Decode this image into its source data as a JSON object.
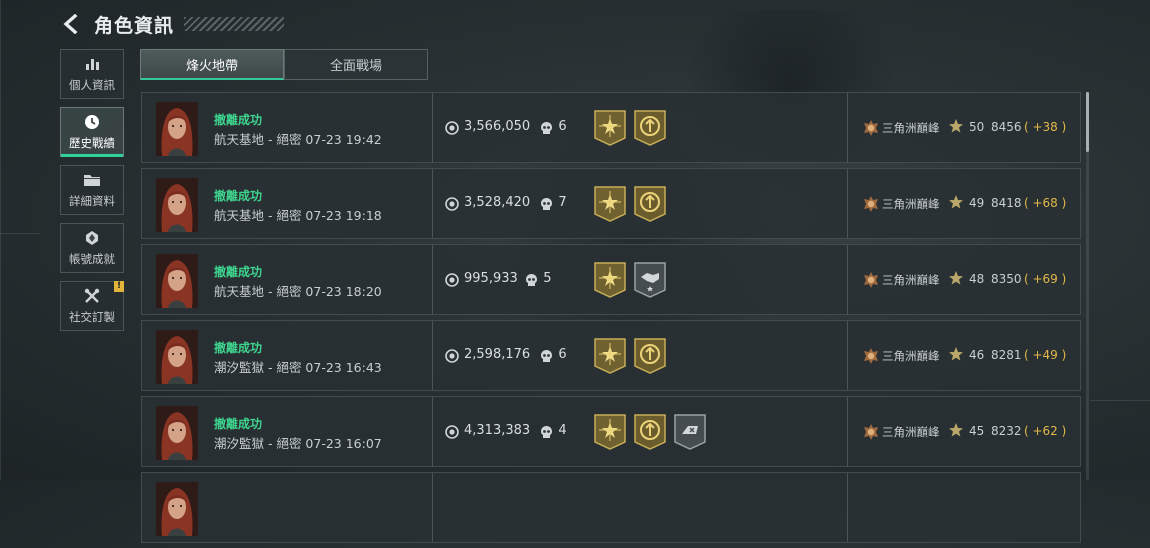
{
  "header": {
    "title": "角色資訊",
    "back_icon": "chevron-left-icon"
  },
  "nav": [
    {
      "label": "個人資訊",
      "icon": "bar-chart-icon",
      "active": false
    },
    {
      "label": "歷史戰績",
      "icon": "clock-icon",
      "active": true
    },
    {
      "label": "詳細資料",
      "icon": "folder-icon",
      "active": false
    },
    {
      "label": "帳號成就",
      "icon": "achievement-icon",
      "active": false
    },
    {
      "label": "社交訂製",
      "icon": "tools-icon",
      "active": false,
      "badge": "!"
    }
  ],
  "tabs": [
    {
      "label": "烽火地帶",
      "active": true
    },
    {
      "label": "全面戰場",
      "active": false
    }
  ],
  "records": [
    {
      "status": "撤離成功",
      "map": "航天基地 - 絕密 07-23 19:42",
      "value": "3,566,050",
      "kills": "6",
      "badges": [
        "gold-star-badge",
        "gold-shield-badge"
      ],
      "rank": "三角洲巔峰",
      "level": "50",
      "score": "8456",
      "delta": "( +38 )"
    },
    {
      "status": "撤離成功",
      "map": "航天基地 - 絕密 07-23 19:18",
      "value": "3,528,420",
      "kills": "7",
      "badges": [
        "gold-star-badge",
        "gold-shield-badge"
      ],
      "rank": "三角洲巔峰",
      "level": "49",
      "score": "8418",
      "delta": "( +68 )"
    },
    {
      "status": "撤離成功",
      "map": "航天基地 - 絕密 07-23 18:20",
      "value": "995,933",
      "kills": "5",
      "badges": [
        "gold-star-badge",
        "grey-handshake-badge"
      ],
      "rank": "三角洲巔峰",
      "level": "48",
      "score": "8350",
      "delta": "( +69 )"
    },
    {
      "status": "撤離成功",
      "map": "潮汐監獄 - 絕密 07-23 16:43",
      "value": "2,598,176",
      "kills": "6",
      "badges": [
        "gold-star-badge",
        "gold-shield-badge"
      ],
      "rank": "三角洲巔峰",
      "level": "46",
      "score": "8281",
      "delta": "( +49 )"
    },
    {
      "status": "撤離成功",
      "map": "潮汐監獄 - 絕密 07-23 16:07",
      "value": "4,313,383",
      "kills": "4",
      "badges": [
        "gold-star-badge",
        "gold-shield-badge",
        "grey-item-badge"
      ],
      "rank": "三角洲巔峰",
      "level": "45",
      "score": "8232",
      "delta": "( +62 )"
    }
  ],
  "colors": {
    "accent": "#2fd39a",
    "success": "#3ed48e",
    "delta": "#e3b84a",
    "gold": "#b9a050"
  }
}
